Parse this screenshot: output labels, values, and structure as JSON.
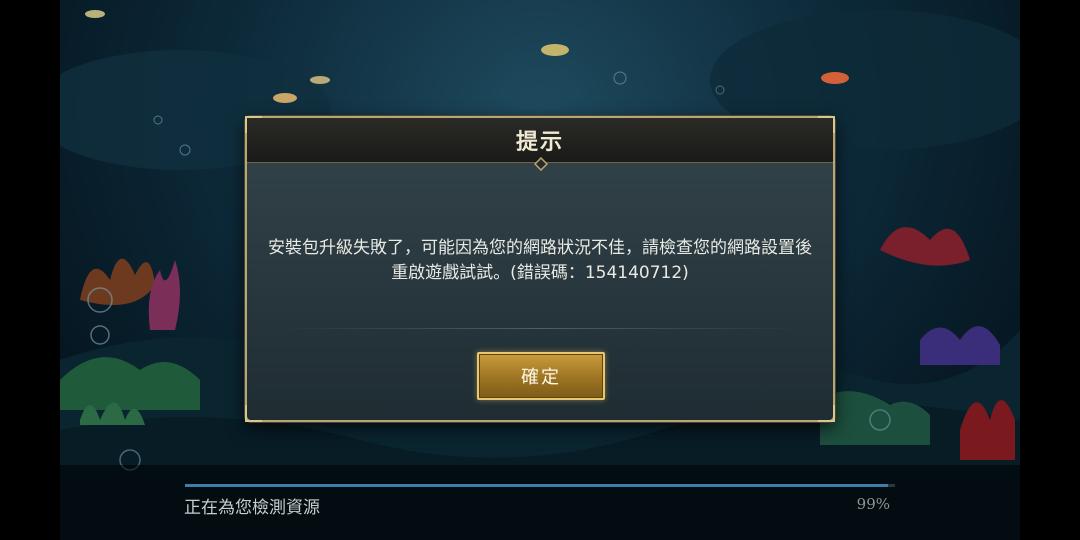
{
  "dialog": {
    "title": "提示",
    "message": "安裝包升級失敗了，可能因為您的網路狀況不佳，請檢查您的網路設置後重啟遊戲試試。(錯誤碼：154140712)",
    "ok_label": "確定"
  },
  "loading": {
    "status_text": "正在為您檢測資源",
    "percent_text": "99%",
    "progress": 0.99
  },
  "colors": {
    "accent_gold": "#e7c86e",
    "dialog_border": "#b7a774",
    "progress": "#3d7fa6"
  }
}
